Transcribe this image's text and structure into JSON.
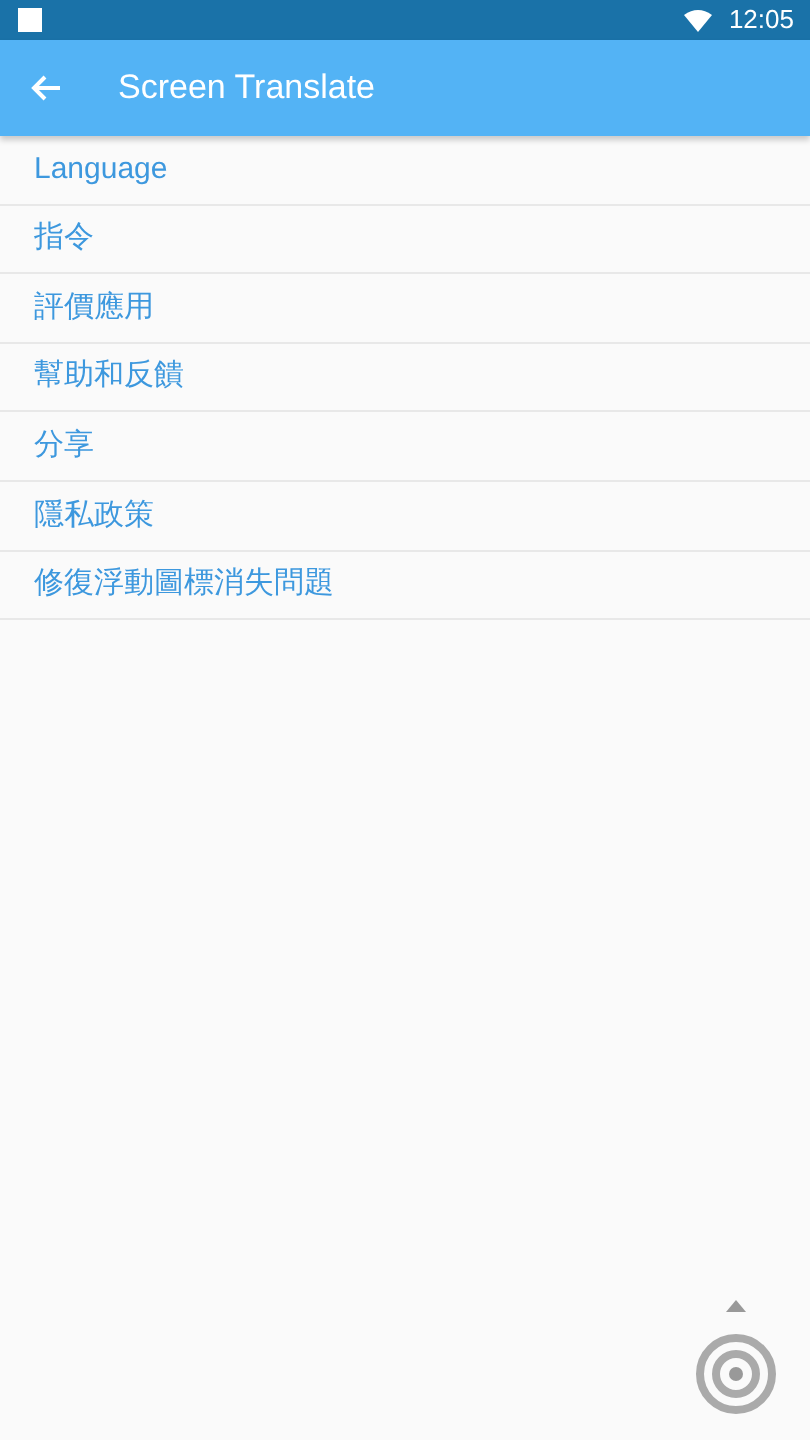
{
  "status_bar": {
    "time": "12:05"
  },
  "app_bar": {
    "title": "Screen Translate"
  },
  "menu": [
    {
      "label": "Language"
    },
    {
      "label": "指令"
    },
    {
      "label": "評價應用"
    },
    {
      "label": "幫助和反饋"
    },
    {
      "label": "分享"
    },
    {
      "label": "隱私政策"
    },
    {
      "label": "修復浮動圖標消失問題"
    }
  ]
}
